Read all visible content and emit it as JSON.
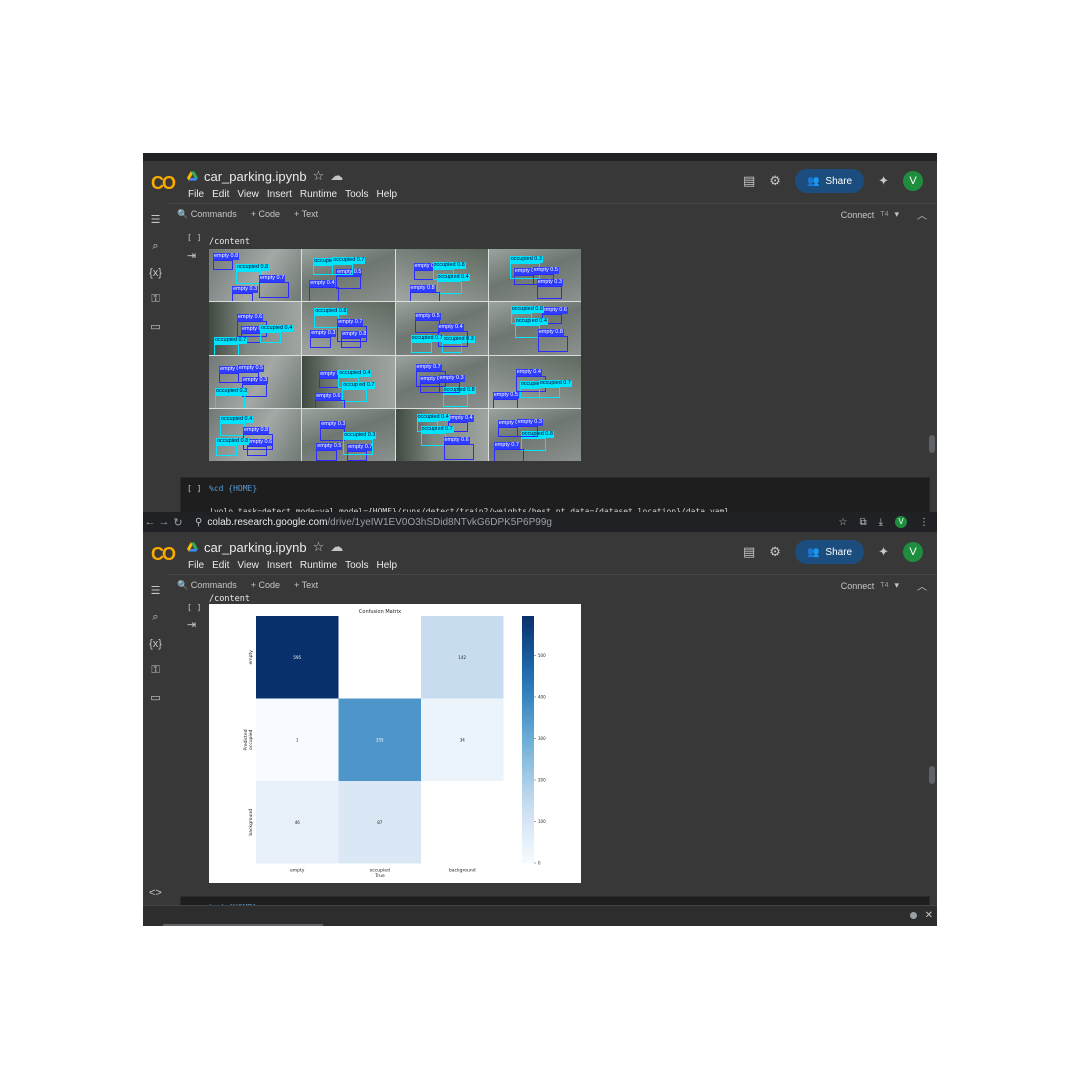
{
  "app": {
    "logo": "CO",
    "notebook_title": "car_parking.ipynb",
    "menus": [
      "File",
      "Edit",
      "View",
      "Insert",
      "Runtime",
      "Tools",
      "Help"
    ],
    "share_label": "Share",
    "avatar_letter": "V",
    "toolbar": {
      "commands": "Commands",
      "add_code": "+ Code",
      "add_text": "+ Text",
      "connect": "Connect",
      "ram": "T4"
    },
    "colors": {
      "accent": "#1b4e7f",
      "logo_orange": "#f9ab00",
      "avatar": "#1e8e3e"
    }
  },
  "browser": {
    "url_domain": "colab.research.google.com",
    "url_path": "/drive/1yeIW1EV0O3hSDid8NTvkG6DPK5P6P99g"
  },
  "shot1": {
    "cell_prompt": "[ ]",
    "output_path": "/content",
    "next_cell_prompt": "[ ]",
    "next_cell_code": "%cd {HOME}",
    "next_cell_code2": "!yolo task=detect mode=val model={HOME}/runs/detect/train2/weights/best.pt data={dataset.location}/data.yaml",
    "detection_labels": [
      "empty 0.8",
      "occupied 0.8",
      "empty 0.7",
      "empty 0.3",
      "occupied 0.3",
      "empty 0.5",
      "empty 0.4",
      "occupied 0.7",
      "empty 0.6",
      "occupied 0.4"
    ]
  },
  "shot2": {
    "cell_prompt": "[ ]",
    "output_path": "/content",
    "next_cell_code": "%cd {HOME}"
  },
  "chart_data": {
    "type": "heatmap",
    "title": "Confusion Matrix",
    "xlabel": "True",
    "ylabel": "Predicted",
    "x_categories": [
      "empty",
      "occupied",
      "background"
    ],
    "y_categories": [
      "empty",
      "occupied",
      "background"
    ],
    "values": [
      [
        595,
        null,
        142
      ],
      [
        1,
        355,
        34
      ],
      [
        46,
        87,
        null
      ]
    ],
    "colorbar_ticks": [
      0,
      100,
      200,
      300,
      400,
      500
    ],
    "vmin": 0,
    "vmax": 595,
    "colormap": "Blues"
  }
}
